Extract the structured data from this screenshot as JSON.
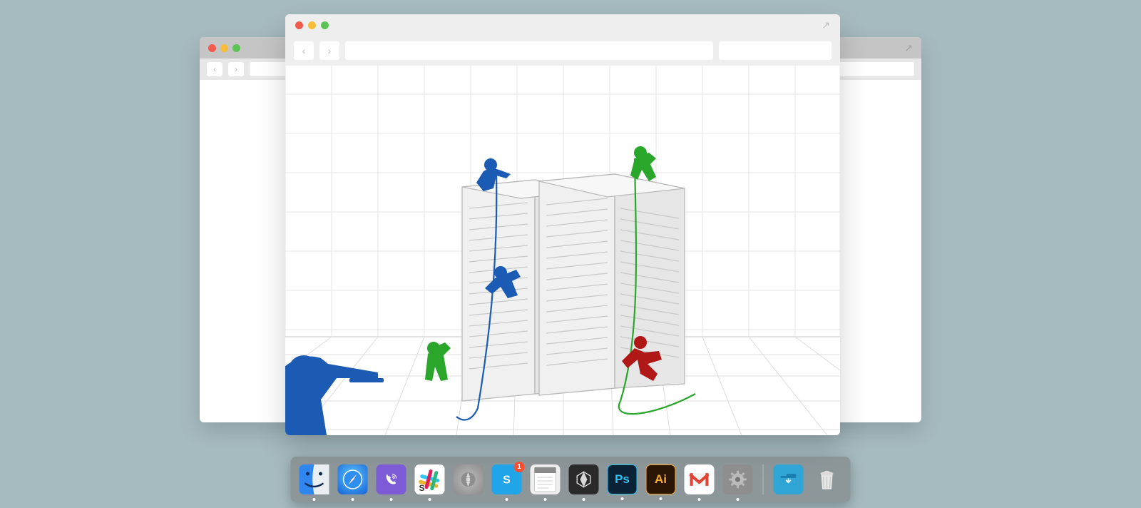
{
  "background_color": "#a6bbc0",
  "windows": {
    "back": {
      "traffic_lights": [
        "close",
        "minimize",
        "zoom"
      ],
      "nav": {
        "back": "‹",
        "forward": "›"
      },
      "address_value": "",
      "expand_icon": "↗"
    },
    "front": {
      "traffic_lights": [
        "close",
        "minimize",
        "zoom"
      ],
      "nav": {
        "back": "‹",
        "forward": "›"
      },
      "address_value": "",
      "search_value": "",
      "expand_icon": "↗"
    }
  },
  "illustration": {
    "description": "Two grey server racks on a perspective grid; blue, green and red silhouette figures rappelling/climbing around them",
    "figures": [
      {
        "color": "blue",
        "pose": "kneeling-sniper-foreground"
      },
      {
        "color": "blue",
        "pose": "crouched-on-server-top-left"
      },
      {
        "color": "blue",
        "pose": "rappelling-front-face"
      },
      {
        "color": "green",
        "pose": "standing-on-server-top-right"
      },
      {
        "color": "green",
        "pose": "approaching-ground-left"
      },
      {
        "color": "red",
        "pose": "falling-right-side"
      }
    ]
  },
  "dock": {
    "apps": [
      {
        "id": "finder",
        "name": "Finder",
        "running": true
      },
      {
        "id": "safari",
        "name": "Safari",
        "running": true
      },
      {
        "id": "viber",
        "name": "Viber",
        "running": true
      },
      {
        "id": "slack",
        "name": "Slack",
        "running": true
      },
      {
        "id": "launchpad",
        "name": "Launchpad",
        "running": false
      },
      {
        "id": "skype",
        "name": "Skype",
        "running": true,
        "badge": "1"
      },
      {
        "id": "textedit",
        "name": "TextEdit",
        "running": true
      },
      {
        "id": "unity",
        "name": "Unity",
        "running": true
      },
      {
        "id": "photoshop",
        "name": "Adobe Photoshop",
        "running": true,
        "label": "Ps"
      },
      {
        "id": "illustrator",
        "name": "Adobe Illustrator",
        "running": true,
        "label": "Ai"
      },
      {
        "id": "gmail",
        "name": "Gmail",
        "running": true
      },
      {
        "id": "settings",
        "name": "System Preferences",
        "running": true
      }
    ],
    "right": [
      {
        "id": "downloads",
        "name": "Downloads"
      },
      {
        "id": "trash",
        "name": "Trash"
      }
    ]
  }
}
